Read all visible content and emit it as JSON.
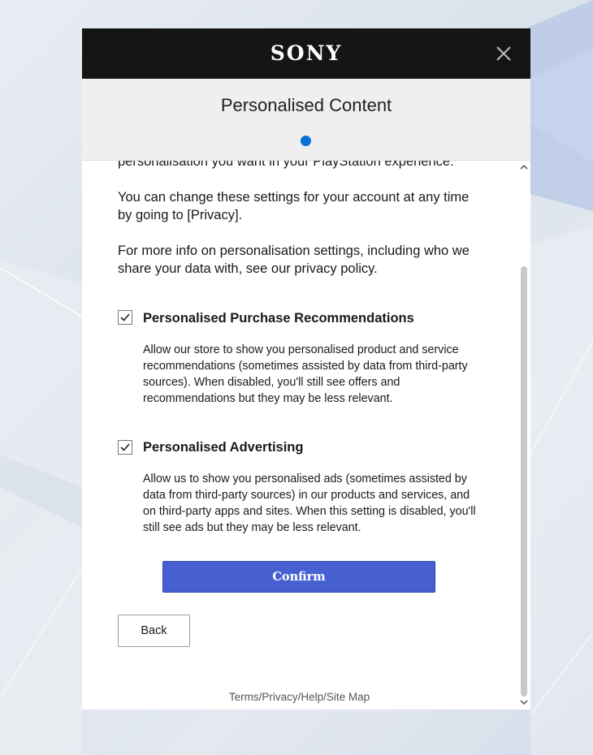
{
  "brand": "SONY",
  "title": "Personalised Content",
  "intro_partial": "personalisation you want in your PlayStation experience.",
  "paragraph_change": "You can change these settings for your account at any time by going to [Privacy].",
  "paragraph_info": "For more info on personalisation settings, including who we share your data with, see our privacy policy.",
  "options": [
    {
      "title": "Personalised Purchase Recommendations",
      "checked": true,
      "description": "Allow our store to show you personalised product and service recommendations (sometimes assisted by data from third-party sources). When disabled, you'll still see offers and recommendations but they may be less relevant."
    },
    {
      "title": "Personalised Advertising",
      "checked": true,
      "description": "Allow us to show you personalised ads (sometimes assisted by data from third-party sources) in our products and services, and on third-party apps and sites. When this setting is disabled, you'll still see ads but they may be less relevant."
    }
  ],
  "buttons": {
    "confirm": "Confirm",
    "back": "Back"
  },
  "footer": {
    "terms": "Terms",
    "privacy": "Privacy",
    "help": "Help",
    "sitemap": "Site Map",
    "separator": "/"
  },
  "icons": {
    "close": "close-icon",
    "checkbox": "checkmark-icon",
    "scroll_up": "chevron-up-icon",
    "scroll_down": "chevron-down-icon",
    "progress": "progress-dot"
  },
  "colors": {
    "topbar": "#151515",
    "accent": "#4660d2",
    "progress_dot": "#0a6fd6",
    "header_bg": "#efefef"
  }
}
